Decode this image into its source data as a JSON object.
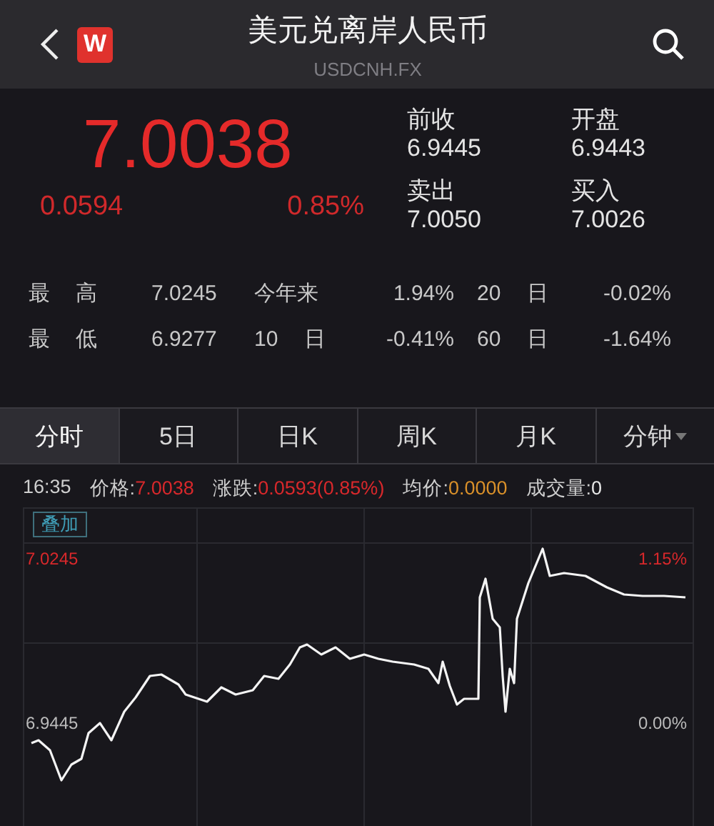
{
  "header": {
    "title": "美元兑离岸人民币",
    "subtitle": "USDCNH.FX",
    "logo": "W"
  },
  "quote": {
    "price": "7.0038",
    "change": "0.0594",
    "change_pct": "0.85%",
    "fields": [
      {
        "label": "前收",
        "value": "6.9445"
      },
      {
        "label": "开盘",
        "value": "6.9443"
      },
      {
        "label": "卖出",
        "value": "7.0050"
      },
      {
        "label": "买入",
        "value": "7.0026"
      }
    ]
  },
  "stats": [
    [
      {
        "label": "最 高",
        "value": "7.0245"
      },
      {
        "label": "今年来",
        "value": "1.94%"
      },
      {
        "label": "20 日",
        "value": "-0.02%"
      }
    ],
    [
      {
        "label": "最 低",
        "value": "6.9277"
      },
      {
        "label": "10 日",
        "value": "-0.41%"
      },
      {
        "label": "60 日",
        "value": "-1.64%"
      }
    ]
  ],
  "tabs": [
    {
      "label": "分时",
      "selected": true,
      "kind": "plain"
    },
    {
      "label": "5日",
      "selected": false,
      "kind": "plain"
    },
    {
      "label": "日K",
      "selected": false,
      "kind": "plain"
    },
    {
      "label": "周K",
      "selected": false,
      "kind": "plain"
    },
    {
      "label": "月K",
      "selected": false,
      "kind": "plain"
    },
    {
      "label": "分钟",
      "selected": false,
      "kind": "dropdown"
    }
  ],
  "info": {
    "time": "16:35",
    "items": [
      {
        "label": "价格:",
        "value": "7.0038",
        "color": "#d8282b"
      },
      {
        "label": "涨跌:",
        "value": "0.0593(0.85%)",
        "color": "#d8282b"
      },
      {
        "label": "均价:",
        "value": "0.0000",
        "color": "#d9902a"
      },
      {
        "label": "成交量:",
        "value": "0",
        "color": "#e8e8e8"
      }
    ]
  },
  "chart": {
    "overlay_button": "叠加",
    "price_high": "7.0245",
    "price_base": "6.9445",
    "pct_high": "1.15%",
    "pct_base": "0.00%"
  }
}
